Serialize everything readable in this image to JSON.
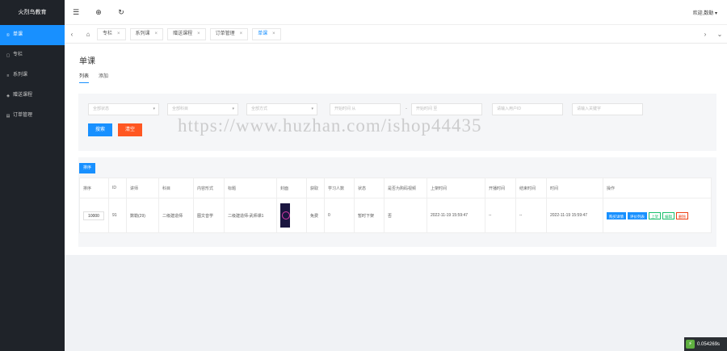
{
  "brand": "火烈鸟教育",
  "sidebar": {
    "items": [
      {
        "label": "单课",
        "icon": "①",
        "icon_name": "circle-icon",
        "active": true
      },
      {
        "label": "专栏",
        "icon": "▢",
        "icon_name": "column-icon",
        "active": false
      },
      {
        "label": "系列课",
        "icon": "≡",
        "icon_name": "series-icon",
        "active": false
      },
      {
        "label": "赠送课程",
        "icon": "◈",
        "icon_name": "gift-icon",
        "active": false
      },
      {
        "label": "订单管理",
        "icon": "▤",
        "icon_name": "order-icon",
        "active": false
      }
    ]
  },
  "topbar": {
    "menu_icon": "☰",
    "globe_icon": "⊕",
    "refresh_icon": "↻",
    "user_greeting": "欢迎,数勒 ▾"
  },
  "tabs": {
    "prev_icon": "‹",
    "home_icon": "⌂",
    "items": [
      {
        "label": "专栏",
        "active": false
      },
      {
        "label": "系列课",
        "active": false
      },
      {
        "label": "赠送课程",
        "active": false
      },
      {
        "label": "订单管理",
        "active": false
      },
      {
        "label": "单课",
        "active": true
      }
    ],
    "close_icon": "×",
    "next_icon": "›",
    "more_icon": "⌄"
  },
  "page": {
    "title": "单课",
    "subtabs": [
      {
        "label": "列表",
        "active": true
      },
      {
        "label": "添加",
        "active": false
      }
    ]
  },
  "filters": {
    "status_placeholder": "全部状态",
    "subject_placeholder": "全部科目",
    "form_placeholder": "全部方式",
    "start_time_placeholder": "开始时间 从",
    "range_separator": "-",
    "end_time_placeholder": "开始时间 至",
    "keyword_placeholder": "请输入用户ID",
    "teacher_placeholder": "请输入关键字",
    "caret": "▾",
    "search_label": "搜索",
    "clear_label": "清空"
  },
  "table": {
    "sort_button": "排序",
    "headers": [
      "排序",
      "ID",
      "讲师",
      "科目",
      "内容形式",
      "标题",
      "封面",
      "获取",
      "学习人数",
      "状态",
      "是否为购码视频",
      "上架时间",
      "开播时间",
      "结束时间",
      "时间",
      "操作"
    ],
    "rows": [
      {
        "sort": "10000",
        "id": "91",
        "teacher": "数勒(29)",
        "subject": "二级建造师",
        "content_form": "图文音学",
        "title": "二级建造师-武师课1",
        "cover_icon": "course-cover-image",
        "access": "免费",
        "learners": "0",
        "status": "暂时下架",
        "is_code_video": "否",
        "listed_time": "2022-11-19 15:59:47",
        "start_time": "--",
        "end_time": "--",
        "time": "2022-11-19 15:59:47",
        "actions": [
          {
            "label": "购买详情",
            "style": "blue"
          },
          {
            "label": "评价列表",
            "style": "blue"
          },
          {
            "label": "上架",
            "style": "green"
          },
          {
            "label": "编辑",
            "style": "green"
          },
          {
            "label": "删除",
            "style": "red"
          }
        ]
      }
    ]
  },
  "watermark": "https://www.huzhan.com/ishop44435",
  "timer": {
    "logo": "⚡",
    "value": "0.054269s"
  },
  "colors": {
    "primary": "#1890ff",
    "danger": "#ff5722",
    "sidebar": "#1f2329"
  }
}
